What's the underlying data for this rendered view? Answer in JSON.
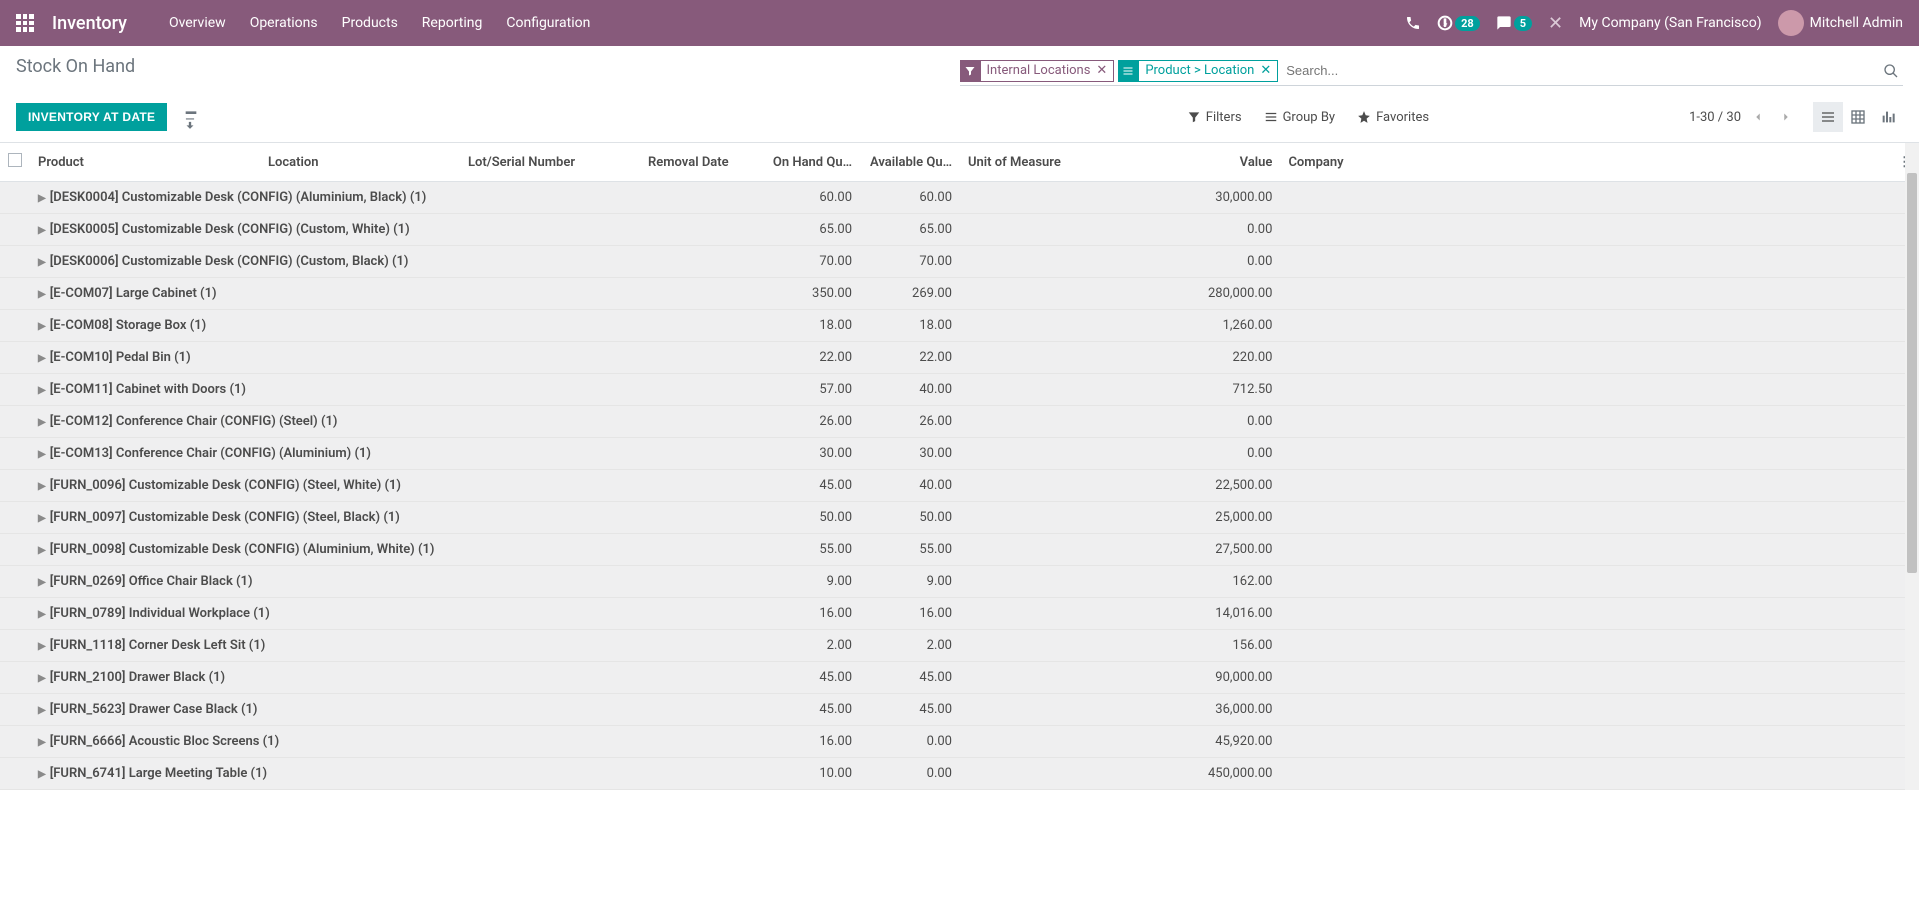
{
  "navbar": {
    "app_title": "Inventory",
    "menu": [
      "Overview",
      "Operations",
      "Products",
      "Reporting",
      "Configuration"
    ],
    "activity_badge": "28",
    "message_badge": "5",
    "company": "My Company (San Francisco)",
    "user": "Mitchell Admin"
  },
  "cp": {
    "breadcrumb": "Stock On Hand",
    "facet_filter": "Internal Locations",
    "facet_group": "Product > Location",
    "search_placeholder": "Search...",
    "btn_inventory": "INVENTORY AT DATE",
    "filters": "Filters",
    "groupby": "Group By",
    "favorites": "Favorites",
    "pager": "1-30 / 30"
  },
  "columns": {
    "product": "Product",
    "location": "Location",
    "lot": "Lot/Serial Number",
    "removal": "Removal Date",
    "onhand": "On Hand Qu…",
    "available": "Available Qu…",
    "uom": "Unit of Measure",
    "value": "Value",
    "company": "Company"
  },
  "rows": [
    {
      "product": "[DESK0004] Customizable Desk (CONFIG) (Aluminium, Black) (1)",
      "onhand": "60.00",
      "available": "60.00",
      "value": "30,000.00"
    },
    {
      "product": "[DESK0005] Customizable Desk (CONFIG) (Custom, White) (1)",
      "onhand": "65.00",
      "available": "65.00",
      "value": "0.00"
    },
    {
      "product": "[DESK0006] Customizable Desk (CONFIG) (Custom, Black) (1)",
      "onhand": "70.00",
      "available": "70.00",
      "value": "0.00"
    },
    {
      "product": "[E-COM07] Large Cabinet (1)",
      "onhand": "350.00",
      "available": "269.00",
      "value": "280,000.00"
    },
    {
      "product": "[E-COM08] Storage Box (1)",
      "onhand": "18.00",
      "available": "18.00",
      "value": "1,260.00"
    },
    {
      "product": "[E-COM10] Pedal Bin (1)",
      "onhand": "22.00",
      "available": "22.00",
      "value": "220.00"
    },
    {
      "product": "[E-COM11] Cabinet with Doors (1)",
      "onhand": "57.00",
      "available": "40.00",
      "value": "712.50"
    },
    {
      "product": "[E-COM12] Conference Chair (CONFIG) (Steel) (1)",
      "onhand": "26.00",
      "available": "26.00",
      "value": "0.00"
    },
    {
      "product": "[E-COM13] Conference Chair (CONFIG) (Aluminium) (1)",
      "onhand": "30.00",
      "available": "30.00",
      "value": "0.00"
    },
    {
      "product": "[FURN_0096] Customizable Desk (CONFIG) (Steel, White) (1)",
      "onhand": "45.00",
      "available": "40.00",
      "value": "22,500.00"
    },
    {
      "product": "[FURN_0097] Customizable Desk (CONFIG) (Steel, Black) (1)",
      "onhand": "50.00",
      "available": "50.00",
      "value": "25,000.00"
    },
    {
      "product": "[FURN_0098] Customizable Desk (CONFIG) (Aluminium, White) (1)",
      "onhand": "55.00",
      "available": "55.00",
      "value": "27,500.00"
    },
    {
      "product": "[FURN_0269] Office Chair Black (1)",
      "onhand": "9.00",
      "available": "9.00",
      "value": "162.00"
    },
    {
      "product": "[FURN_0789] Individual Workplace (1)",
      "onhand": "16.00",
      "available": "16.00",
      "value": "14,016.00"
    },
    {
      "product": "[FURN_1118] Corner Desk Left Sit (1)",
      "onhand": "2.00",
      "available": "2.00",
      "value": "156.00"
    },
    {
      "product": "[FURN_2100] Drawer Black (1)",
      "onhand": "45.00",
      "available": "45.00",
      "value": "90,000.00"
    },
    {
      "product": "[FURN_5623] Drawer Case Black (1)",
      "onhand": "45.00",
      "available": "45.00",
      "value": "36,000.00"
    },
    {
      "product": "[FURN_6666] Acoustic Bloc Screens (1)",
      "onhand": "16.00",
      "available": "0.00",
      "value": "45,920.00"
    },
    {
      "product": "[FURN_6741] Large Meeting Table (1)",
      "onhand": "10.00",
      "available": "0.00",
      "value": "450,000.00"
    }
  ]
}
